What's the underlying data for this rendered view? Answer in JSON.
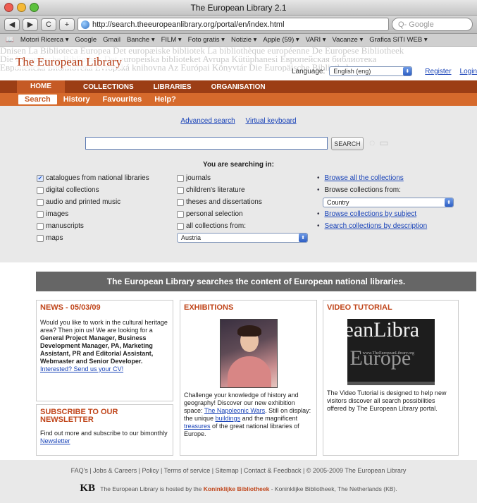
{
  "window": {
    "title": "The European Library 2.1"
  },
  "toolbar": {
    "url": "http://search.theeuropeanlibrary.org/portal/en/index.html",
    "search_placeholder": "Q- Google",
    "back": "◀",
    "forward": "▶",
    "reload": "C",
    "add": "+"
  },
  "bookmarks": [
    "Motori Ricerca ▾",
    "Google",
    "Gmail",
    "Banche ▾",
    "FILM ▾",
    "Foto gratis ▾",
    "Notizie ▾",
    "Apple (59) ▾",
    "VARI ▾",
    "Vacanze ▾",
    "Grafica SITI WEB ▾"
  ],
  "header": {
    "banner_lines": [
      "Dnisen La Biblioteca Europea  Det europæiske bibliotek  La bibliothèque européenne  De Europese Bibliotheek",
      "Die Europäische Bibliothek   Det europeiska biblioteket  Avrupa Kütüphanesi  Европейская библиотека",
      "Европейска Библиотека  Evropská knihovna  Az Európai Könyvtár  Die Europäische Bibliothek"
    ],
    "logo": "The European Library",
    "language_label": "Language:",
    "language_value": "English (eng)",
    "register": "Register",
    "login": "Login"
  },
  "nav_main": [
    "HOME",
    "COLLECTIONS",
    "LIBRARIES",
    "ORGANISATION"
  ],
  "nav_sub": [
    "Search",
    "History",
    "Favourites",
    "Help?"
  ],
  "search": {
    "advanced": "Advanced search",
    "keyboard": "Virtual keyboard",
    "button": "SEARCH",
    "searching_in": "You are searching in:",
    "col1": [
      {
        "label": "catalogues from national libraries",
        "checked": true
      },
      {
        "label": "digital collections",
        "checked": false
      },
      {
        "label": "audio and printed music",
        "checked": false
      },
      {
        "label": "images",
        "checked": false
      },
      {
        "label": "manuscripts",
        "checked": false
      },
      {
        "label": "maps",
        "checked": false
      }
    ],
    "col2": [
      {
        "label": "journals",
        "checked": false
      },
      {
        "label": "children's literature",
        "checked": false
      },
      {
        "label": "theses and dissertations",
        "checked": false
      },
      {
        "label": "personal selection",
        "checked": false
      },
      {
        "label": "all collections from:",
        "checked": false
      }
    ],
    "col2_select": "Austria",
    "col3": {
      "browse_all": "Browse all the collections",
      "browse_from": "Browse collections from:",
      "country_select": "Country",
      "by_subject": "Browse collections by subject",
      "by_description": "Search collections by description"
    }
  },
  "banner": "The European Library searches the content of European national libraries.",
  "news": {
    "title": "NEWS - 05/03/09",
    "text1": "Would you like to work in the cultural heritage area? Then join us! We are looking for a",
    "bold": "General Project Manager, Business Development Manager, PA, Marketing Assistant, PR and Editorial Assistant, Webmaster and Senior Developer.",
    "link": "Interested? Send us your CV!"
  },
  "newsletter": {
    "title": "SUBSCRIBE TO OUR NEWSLETTER",
    "text": "Find out more and subscribe to our bimonthly",
    "link": "Newsletter"
  },
  "exhibitions": {
    "title": "EXHIBITIONS",
    "text1": "Challenge your knowledge of history and geography! Discover our new exhibition space:",
    "link1": "The Napoleonic Wars",
    "text2": "Still on display: the unique",
    "link2": "buildings",
    "text3": "and the magnificent",
    "link3": "treasures",
    "text4": "of the great national libraries of Europe."
  },
  "video": {
    "title": "VIDEO TUTORIAL",
    "thumb_line1": "eanLibra",
    "thumb_small": "www.TheEuropeanLibrary.org",
    "thumb_line2": "Europe",
    "text": "The Video Tutorial is designed to help new visitors discover all search possibilities offered by The European Library portal."
  },
  "footer": {
    "links": "FAQ's | Jobs & Careers | Policy | Terms of service | Sitemap | Contact & Feedback | © 2005-2009 The European Library",
    "kb_logo": "KB",
    "hosted": "The European Library is hosted by the",
    "host_name": "Koninklijke Bibliotheek",
    "host_rest": "- Koninklijke Bibliotheek, The Netherlands (KB)."
  },
  "colors": {
    "brand_dark": "#9c3e15",
    "brand_orange": "#d66a2c",
    "title_red": "#c0451a",
    "link": "#1a44b8"
  }
}
